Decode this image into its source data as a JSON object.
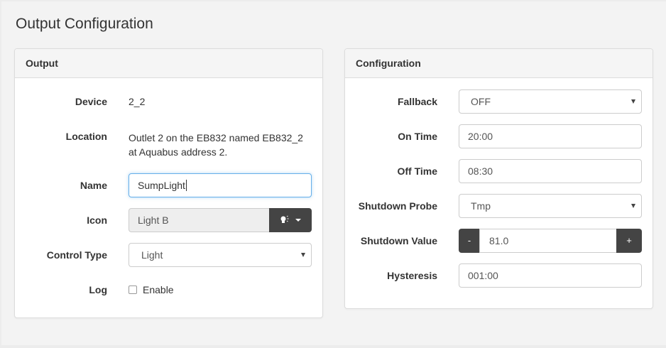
{
  "page": {
    "title": "Output Configuration"
  },
  "output_panel": {
    "heading": "Output",
    "device": {
      "label": "Device",
      "value": "2_2"
    },
    "location": {
      "label": "Location",
      "line1": "Outlet 2 on the EB832 named EB832_2",
      "line2": "at Aquabus address 2."
    },
    "name": {
      "label": "Name",
      "value": "SumpLight"
    },
    "icon": {
      "label": "Icon",
      "value": "Light B",
      "button_icon": "lightbulb-icon"
    },
    "control_type": {
      "label": "Control Type",
      "value": "Light"
    },
    "log": {
      "label": "Log",
      "checkbox_label": "Enable",
      "checked": false
    }
  },
  "config_panel": {
    "heading": "Configuration",
    "fallback": {
      "label": "Fallback",
      "value": "OFF"
    },
    "on_time": {
      "label": "On Time",
      "value": "20:00"
    },
    "off_time": {
      "label": "Off Time",
      "value": "08:30"
    },
    "shutdown_probe": {
      "label": "Shutdown Probe",
      "value": "Tmp"
    },
    "shutdown_value": {
      "label": "Shutdown Value",
      "value": "81.0",
      "minus": "-",
      "plus": "+"
    },
    "hysteresis": {
      "label": "Hysteresis",
      "value": "001:00"
    }
  },
  "colors": {
    "accent_focus": "#66afe9",
    "dark_button": "#444444"
  }
}
